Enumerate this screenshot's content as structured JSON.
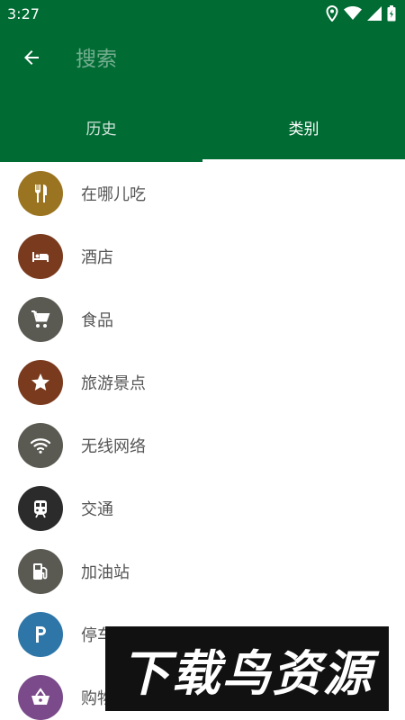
{
  "status_bar": {
    "time": "3:27",
    "icons": [
      "location-icon",
      "wifi-icon",
      "signal-icon",
      "battery-icon"
    ]
  },
  "app_bar": {
    "back_icon": "arrow-left-icon",
    "search_placeholder": "搜索"
  },
  "tabs": [
    {
      "label": "历史",
      "active": false
    },
    {
      "label": "类别",
      "active": true
    }
  ],
  "categories": [
    {
      "label": "在哪儿吃",
      "icon": "fork-knife-icon",
      "color": "#9a7420"
    },
    {
      "label": "酒店",
      "icon": "bed-icon",
      "color": "#7a3a1e"
    },
    {
      "label": "食品",
      "icon": "cart-icon",
      "color": "#5a5a52"
    },
    {
      "label": "旅游景点",
      "icon": "star-icon",
      "color": "#7a3a1e"
    },
    {
      "label": "无线网络",
      "icon": "wifi-icon",
      "color": "#5a5a52"
    },
    {
      "label": "交通",
      "icon": "train-icon",
      "color": "#2b2b2b"
    },
    {
      "label": "加油站",
      "icon": "fuel-icon",
      "color": "#5a5a52"
    },
    {
      "label": "停车场",
      "icon": "parking-icon",
      "color": "#2e76a8"
    },
    {
      "label": "购物",
      "icon": "basket-icon",
      "color": "#7a4a8a"
    }
  ],
  "watermark": {
    "text": "下载鸟资源"
  },
  "colors": {
    "primary": "#006b33",
    "text": "#555555"
  }
}
